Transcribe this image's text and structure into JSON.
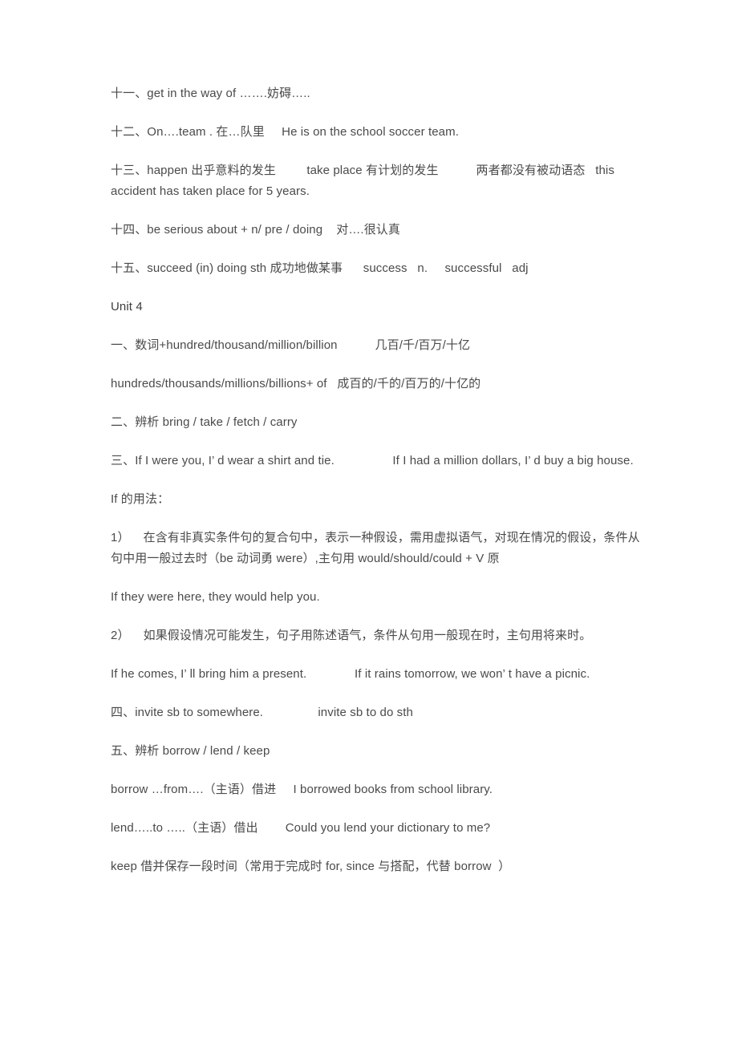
{
  "document": {
    "title": "Unit 4",
    "text_color": "#3d3d3d",
    "background_color": "#ffffff",
    "paragraphs": [
      {
        "id": "item-11",
        "text": "十一、get in the way of …….妨碍….."
      },
      {
        "id": "item-12",
        "text": "十二、On….team . 在…队里     He is on the school soccer team."
      },
      {
        "id": "item-13",
        "text": "十三、happen 出乎意料的发生         take place 有计划的发生           两者都没有被动语态   this accident has taken place for 5 years."
      },
      {
        "id": "item-14",
        "text": "十四、be serious about + n/ pre / doing    对….很认真"
      },
      {
        "id": "item-15",
        "text": "十五、succeed (in) doing sth 成功地做某事      success   n.     successful   adj"
      },
      {
        "id": "unit-heading",
        "text": "Unit 4"
      },
      {
        "id": "unit4-item-1",
        "text": "一、数词+hundred/thousand/million/billion           几百/千/百万/十亿"
      },
      {
        "id": "unit4-item-1b",
        "text": "hundreds/thousands/millions/billions+ of   成百的/千的/百万的/十亿的"
      },
      {
        "id": "unit4-item-2",
        "text": "二、辨析 bring / take / fetch / carry"
      },
      {
        "id": "unit4-item-3",
        "text": "三、If I were you, I’ d wear a shirt and tie.                 If I had a million dollars, I’ d buy a big house."
      },
      {
        "id": "if-usage-heading",
        "text": "If 的用法："
      },
      {
        "id": "if-usage-1",
        "text": "1）    在含有非真实条件句的复合句中，表示一种假设，需用虚拟语气，对现在情况的假设，条件从句中用一般过去时（be 动词勇 were）,主句用 would/should/could + V 原"
      },
      {
        "id": "if-example-1",
        "text": "If they were here, they would help you."
      },
      {
        "id": "if-usage-2",
        "text": "2）    如果假设情况可能发生，句子用陈述语气，条件从句用一般现在时，主句用将来时。"
      },
      {
        "id": "if-example-2",
        "text": "If he comes, I’ ll bring him a present.              If it rains tomorrow, we won’ t have a picnic."
      },
      {
        "id": "unit4-item-4",
        "text": "四、invite sb to somewhere.                invite sb to do sth"
      },
      {
        "id": "unit4-item-5",
        "text": "五、辨析 borrow / lend / keep"
      },
      {
        "id": "borrow-line",
        "text": "borrow …from….（主语）借进     I borrowed books from school library."
      },
      {
        "id": "lend-line",
        "text": "lend…..to …..（主语）借出        Could you lend your dictionary to me?"
      },
      {
        "id": "keep-line",
        "text": "keep 借并保存一段时间（常用于完成时 for, since 与搭配，代替 borrow  ）"
      }
    ]
  }
}
